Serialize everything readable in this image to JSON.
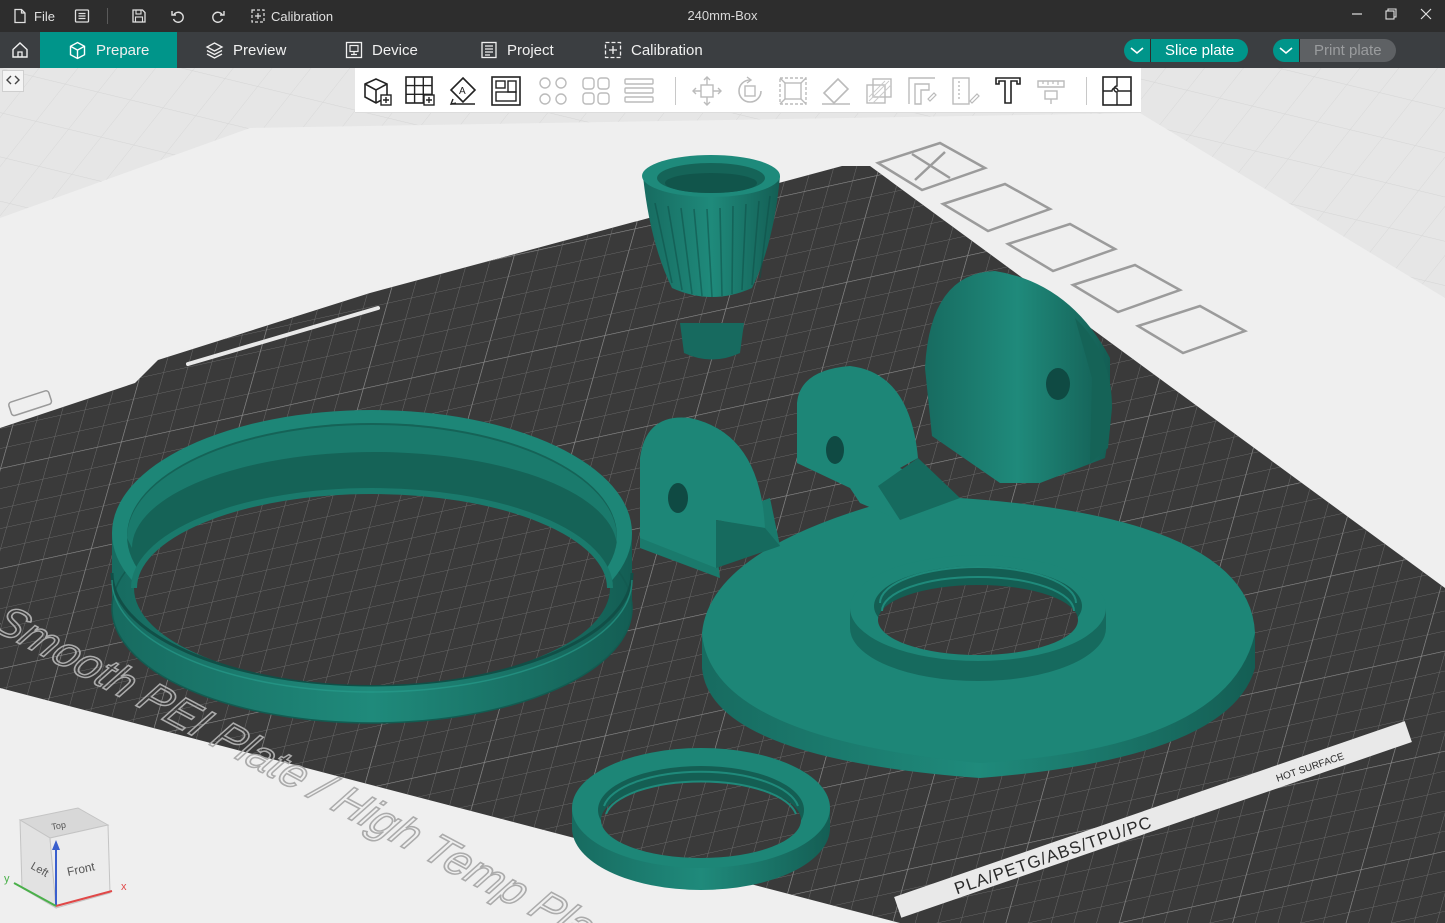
{
  "titlebar": {
    "file_label": "File",
    "calibration_label": "Calibration",
    "window_title": "240mm-Box"
  },
  "nav": {
    "tabs": [
      {
        "label": "Prepare",
        "active": true
      },
      {
        "label": "Preview",
        "active": false
      },
      {
        "label": "Device",
        "active": false
      },
      {
        "label": "Project",
        "active": false
      },
      {
        "label": "Calibration",
        "active": false
      }
    ],
    "slice_label": "Slice plate",
    "print_label": "Print plate"
  },
  "toolbar": {
    "icons": [
      "add-object-icon",
      "arrange-grid-icon",
      "auto-orient-icon",
      "arrange-icon",
      "split-objects-icon",
      "split-parts-icon",
      "layers-icon",
      "move-icon",
      "rotate-icon",
      "scale-icon",
      "lay-on-face-icon",
      "cut-icon",
      "support-paint-icon",
      "seam-paint-icon",
      "text-icon",
      "measure-icon",
      "assembly-icon"
    ]
  },
  "plate": {
    "plate_text": "Smooth PEI Plate / High Temp Plate",
    "material_text": "PLA/PETG/ABS/TPU/PC",
    "hot_surface_text": "HOT SURFACE"
  },
  "view_cube": {
    "top": "Top",
    "left": "Left",
    "front": "Front",
    "axis_x": "x",
    "axis_y": "y",
    "axis_z": "z"
  },
  "colors": {
    "accent": "#00958a",
    "model": "#1d8677",
    "plate": "#3a3a3a"
  }
}
